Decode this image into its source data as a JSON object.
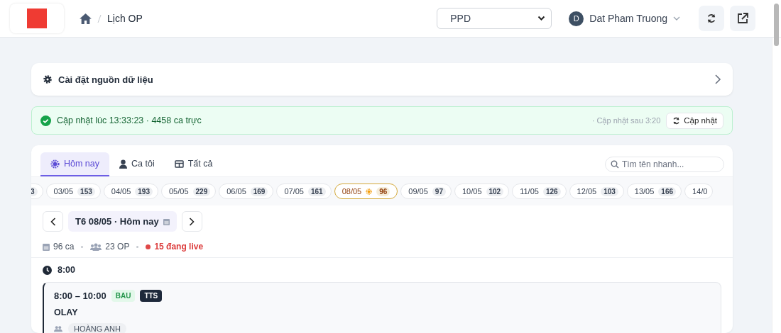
{
  "header": {
    "breadcrumb": "Lịch OP",
    "select": {
      "value": "PPD"
    },
    "user": {
      "initial": "D",
      "name": "Dat Pham Truong"
    }
  },
  "settings": {
    "title": "Cài đặt nguồn dữ liệu"
  },
  "status": {
    "text": "Cập nhật lúc 13:33:23 · 4458 ca trực",
    "next": "· Cập nhật sau 3:20",
    "button": "Cập nhật"
  },
  "tabs": [
    {
      "label": "Hôm nay",
      "kind": "today",
      "selected": true
    },
    {
      "label": "Ca tôi",
      "kind": "mine",
      "selected": false
    },
    {
      "label": "Tất cả",
      "kind": "all",
      "selected": false
    }
  ],
  "search": {
    "placeholder": "Tìm tên nhanh..."
  },
  "dates": [
    {
      "count": "3",
      "selected": false
    },
    {
      "date": "03/05",
      "count": "153",
      "selected": false
    },
    {
      "date": "04/05",
      "count": "193",
      "selected": false
    },
    {
      "date": "05/05",
      "count": "229",
      "selected": false
    },
    {
      "date": "06/05",
      "count": "169",
      "selected": false
    },
    {
      "date": "07/05",
      "count": "161",
      "selected": false
    },
    {
      "date": "08/05",
      "count": "96",
      "selected": true
    },
    {
      "date": "09/05",
      "count": "97",
      "selected": false
    },
    {
      "date": "10/05",
      "count": "102",
      "selected": false
    },
    {
      "date": "11/05",
      "count": "126",
      "selected": false
    },
    {
      "date": "12/05",
      "count": "103",
      "selected": false
    },
    {
      "date": "13/05",
      "count": "166",
      "selected": false
    },
    {
      "date": "14/0",
      "selected": false
    }
  ],
  "day": {
    "label": "T6 08/05 · Hôm nay",
    "shifts": "96 ca",
    "ops": "23 OP",
    "live": "15 đang live"
  },
  "groups": [
    {
      "time": "8:00",
      "items": [
        {
          "range": "8:00 – 10:00",
          "tags": [
            {
              "label": "BAU",
              "kind": "soft"
            },
            {
              "label": "TTS",
              "kind": "dark"
            }
          ],
          "brand": "OLAY",
          "people": [
            "HOÀNG ANH"
          ]
        }
      ]
    }
  ]
}
